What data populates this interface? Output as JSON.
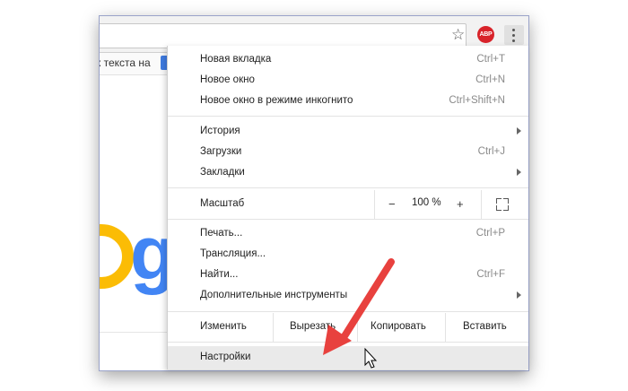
{
  "bookmarks_bar": {
    "partial_text": "к текста на"
  },
  "toolbar": {
    "bookmark_star_icon": "star-icon",
    "adblock_badge": "ABP",
    "menu_icon": "kebab-icon"
  },
  "menu": {
    "group1": [
      {
        "label": "Новая вкладка",
        "shortcut": "Ctrl+T"
      },
      {
        "label": "Новое окно",
        "shortcut": "Ctrl+N"
      },
      {
        "label": "Новое окно в режиме инкогнито",
        "shortcut": "Ctrl+Shift+N"
      }
    ],
    "group2": [
      {
        "label": "История",
        "shortcut": ""
      },
      {
        "label": "Загрузки",
        "shortcut": "Ctrl+J"
      },
      {
        "label": "Закладки",
        "shortcut": ""
      }
    ],
    "zoom": {
      "label": "Масштаб",
      "minus": "−",
      "value": "100 %",
      "plus": "+"
    },
    "group3": [
      {
        "label": "Печать...",
        "shortcut": "Ctrl+P"
      },
      {
        "label": "Трансляция...",
        "shortcut": ""
      },
      {
        "label": "Найти...",
        "shortcut": "Ctrl+F"
      },
      {
        "label": "Дополнительные инструменты",
        "shortcut": ""
      }
    ],
    "edit": {
      "label": "Изменить",
      "cut": "Вырезать",
      "copy": "Копировать",
      "paste": "Вставить"
    },
    "settings": {
      "label": "Настройки"
    }
  },
  "annotation": {
    "arrow_color": "#e8413e"
  }
}
